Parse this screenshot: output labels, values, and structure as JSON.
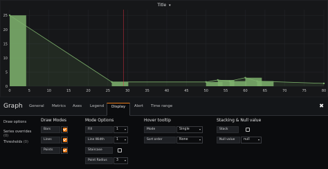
{
  "panel": {
    "title": "Title",
    "title_caret": "▾",
    "series_color": "#7eb26d",
    "threshold_color": "#e02f44",
    "chart_data": {
      "type": "bar",
      "x": [
        0,
        26,
        50,
        53,
        56,
        60,
        63
      ],
      "values": [
        25,
        1.5,
        1.5,
        2.2,
        1.8,
        3,
        1.8
      ],
      "line_x": [
        0,
        26,
        50,
        53,
        56,
        60,
        63,
        80
      ],
      "line_y": [
        25,
        1.5,
        1.5,
        2.2,
        1.8,
        3,
        1.8,
        1
      ],
      "x_ticks": [
        "0",
        "5",
        "10",
        "15",
        "20",
        "25",
        "30",
        "35",
        "40",
        "45",
        "50",
        "55",
        "60",
        "65",
        "70",
        "75",
        "80"
      ],
      "y_ticks": [
        "0",
        "5",
        "10",
        "15",
        "20",
        "25"
      ],
      "xlim": [
        0,
        80
      ],
      "ylim": [
        0,
        27
      ],
      "threshold_x": 29,
      "grid": true,
      "stacked": false,
      "null_value": "null"
    }
  },
  "editor": {
    "title": "Graph",
    "close": "✖",
    "tabs": [
      "General",
      "Metrics",
      "Axes",
      "Legend",
      "Display",
      "Alert",
      "Time range"
    ],
    "active_tab": "Display",
    "side": {
      "draw_options": "Draw options",
      "series_overrides": "Series overrides",
      "series_overrides_count": "(0)",
      "thresholds": "Thresholds",
      "thresholds_count": "(0)"
    },
    "draw_modes": {
      "title": "Draw Modes",
      "bars": "Bars",
      "lines": "Lines",
      "points": "Points"
    },
    "mode_options": {
      "title": "Mode Options",
      "fill": "Fill",
      "fill_value": "1",
      "line_width": "Line Width",
      "line_width_value": "1",
      "staircase": "Staircase",
      "point_radius": "Point Radius",
      "point_radius_value": "3"
    },
    "hover_tooltip": {
      "title": "Hover tooltip",
      "mode": "Mode",
      "mode_value": "Single",
      "sort_order": "Sort order",
      "sort_order_value": "None"
    },
    "stacking": {
      "title": "Stacking & Null value",
      "stack": "Stack",
      "null_value": "Null value",
      "null_value_value": "null"
    },
    "select_arrow": "▾"
  }
}
